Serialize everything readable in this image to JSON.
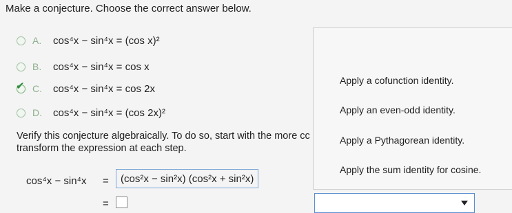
{
  "prompt": "Make a conjecture. Choose the correct answer below.",
  "options": [
    {
      "letter": "A.",
      "math": "cos⁴x − sin⁴x = (cos x)²",
      "checked": false
    },
    {
      "letter": "B.",
      "math": "cos⁴x − sin⁴x = cos x",
      "checked": false
    },
    {
      "letter": "C.",
      "math": "cos⁴x − sin⁴x = cos 2x",
      "checked": true
    },
    {
      "letter": "D.",
      "math": "cos⁴x − sin⁴x = (cos 2x)²",
      "checked": false
    }
  ],
  "check_symbol": "✔",
  "verify": {
    "line1": "Verify this conjecture algebraically. To do so, start with the more cc",
    "line2": "transform the expression at each step."
  },
  "work": {
    "lhs": "cos⁴x − sin⁴x",
    "eq": "=",
    "step1": "(cos²x − sin²x) (cos²x + sin²x)",
    "eq2": "="
  },
  "menu": [
    "Apply a cofunction identity.",
    "Apply an even-odd identity.",
    "Apply a Pythagorean identity.",
    "Apply the sum identity for cosine."
  ],
  "colors": {
    "check": "#2e8b3a",
    "accent": "#5b8ed0"
  }
}
